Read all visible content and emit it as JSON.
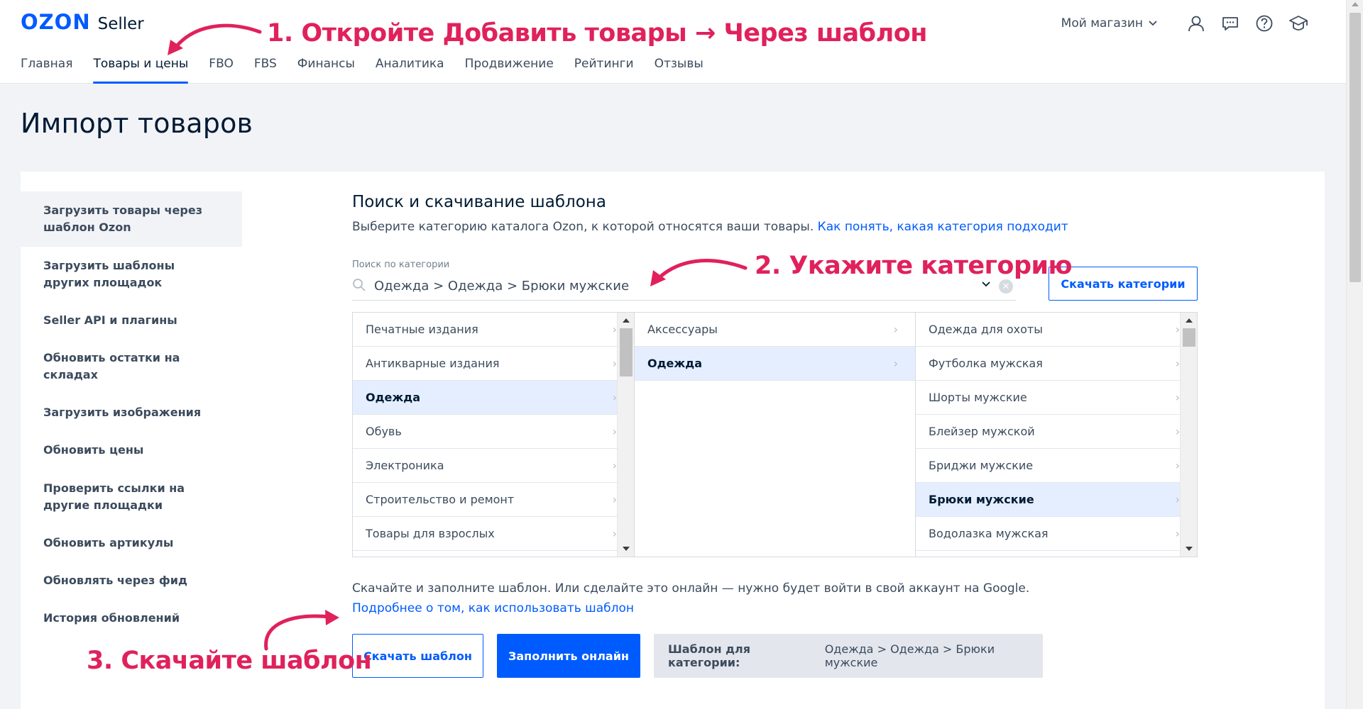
{
  "header": {
    "logo_brand": "OZON",
    "logo_product": "Seller",
    "store_label": "Мой магазин",
    "nav": [
      {
        "label": "Главная"
      },
      {
        "label": "Товары и цены",
        "active": true
      },
      {
        "label": "FBO"
      },
      {
        "label": "FBS"
      },
      {
        "label": "Финансы"
      },
      {
        "label": "Аналитика"
      },
      {
        "label": "Продвижение"
      },
      {
        "label": "Рейтинги"
      },
      {
        "label": "Отзывы"
      }
    ],
    "icons": [
      "user-icon",
      "chat-icon",
      "help-icon",
      "education-icon"
    ]
  },
  "page": {
    "title": "Импорт товаров"
  },
  "sidebar": {
    "items": [
      {
        "label": "Загрузить товары через шаблон Ozon",
        "active": true
      },
      {
        "label": "Загрузить шаблоны других площадок"
      },
      {
        "label": "Seller API и плагины"
      },
      {
        "label": "Обновить остатки на складах"
      },
      {
        "label": "Загрузить изображения"
      },
      {
        "label": "Обновить цены"
      },
      {
        "label": "Проверить ссылки на другие площадки"
      },
      {
        "label": "Обновить артикулы"
      },
      {
        "label": "Обновлять через фид"
      },
      {
        "label": "История обновлений"
      }
    ]
  },
  "main": {
    "section_title": "Поиск и скачивание шаблона",
    "section_sub": "Выберите категорию каталога Ozon, к которой относятся ваши товары.",
    "section_link": "Как понять, какая категория подходит",
    "search_label": "Поиск по категории",
    "search_value": "Одежда > Одежда > Брюки мужские",
    "download_categories": "Скачать категории",
    "columns": [
      [
        "Печатные издания",
        "Антикварные издания",
        "Одежда",
        "Обувь",
        "Электроника",
        "Строительство и ремонт",
        "Товары для взрослых"
      ],
      [
        "Аксессуары",
        "Одежда"
      ],
      [
        "Одежда для охоты",
        "Футболка мужская",
        "Шорты мужские",
        "Блейзер мужской",
        "Бриджи мужские",
        "Брюки мужские",
        "Водолазка мужская"
      ]
    ],
    "selected": [
      "Одежда",
      "Одежда",
      "Брюки мужские"
    ],
    "info_text": "Скачайте и заполните шаблон. Или сделайте это онлайн — нужно будет войти в свой аккаунт на Google.",
    "info_link": "Подробнее о том, как использовать шаблон",
    "download_template": "Скачать шаблон",
    "fill_online": "Заполнить онлайн",
    "template_for_label": "Шаблон для категории:",
    "template_for_value": "Одежда > Одежда > Брюки мужские"
  },
  "annotations": {
    "step1": "1. Откройте Добавить товары → Через шаблон",
    "step2": "2. Укажите категорию",
    "step3": "3. Скачайте шаблон"
  },
  "colors": {
    "accent": "#005bff",
    "annotation": "#e0215c",
    "selected_row": "#e5eeff"
  }
}
